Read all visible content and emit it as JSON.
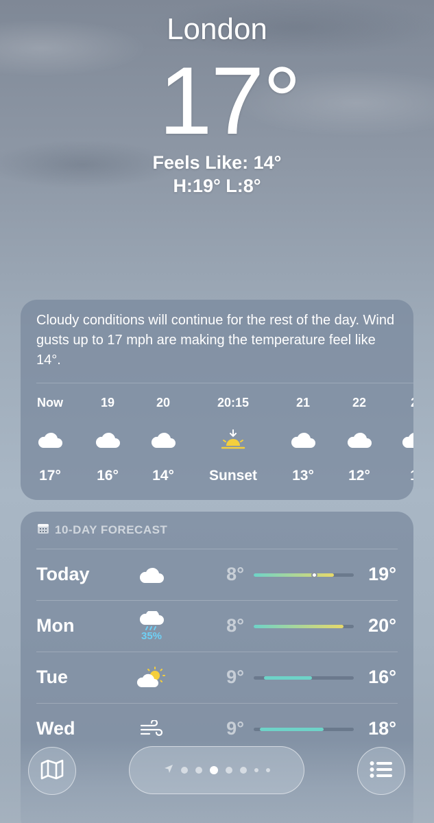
{
  "header": {
    "city": "London",
    "temperature": "17°",
    "feels_like": "Feels Like: 14°",
    "high_low": "H:19°  L:8°"
  },
  "hourly_card": {
    "summary": "Cloudy conditions will continue for the rest of the day. Wind gusts up to 17 mph are making the temperature feel like 14°.",
    "hours": [
      {
        "time": "Now",
        "icon": "cloud-icon",
        "temp": "17°"
      },
      {
        "time": "19",
        "icon": "cloud-icon",
        "temp": "16°"
      },
      {
        "time": "20",
        "icon": "cloud-icon",
        "temp": "14°"
      },
      {
        "time": "20:15",
        "icon": "sunset-icon",
        "temp": "Sunset"
      },
      {
        "time": "21",
        "icon": "cloud-icon",
        "temp": "13°"
      },
      {
        "time": "22",
        "icon": "cloud-icon",
        "temp": "12°"
      },
      {
        "time": "2",
        "icon": "cloud-icon",
        "temp": "1"
      }
    ]
  },
  "forecast": {
    "title": "10-DAY FORECAST",
    "title_icon": "calendar-icon",
    "days": [
      {
        "day": "Today",
        "icon": "cloud-icon",
        "precip": "",
        "low": "8°",
        "high": "19°",
        "bar_start": 0.0,
        "bar_end": 0.8,
        "current": 0.6
      },
      {
        "day": "Mon",
        "icon": "rain-cloud-icon",
        "precip": "35%",
        "low": "8°",
        "high": "20°",
        "bar_start": 0.0,
        "bar_end": 0.9
      },
      {
        "day": "Tue",
        "icon": "partly-sunny-icon",
        "precip": "",
        "low": "9°",
        "high": "16°",
        "bar_start": 0.1,
        "bar_end": 0.58
      },
      {
        "day": "Wed",
        "icon": "wind-icon",
        "precip": "",
        "low": "9°",
        "high": "18°",
        "bar_start": 0.06,
        "bar_end": 0.7
      }
    ]
  },
  "bottom_bar": {
    "left_icon": "map-icon",
    "right_icon": "list-icon",
    "pages": 8,
    "active_page": 3
  },
  "colors": {
    "precip": "#6fd0f5",
    "bar_cool": "#6ed3c8",
    "bar_warm": "#e7d96a"
  }
}
